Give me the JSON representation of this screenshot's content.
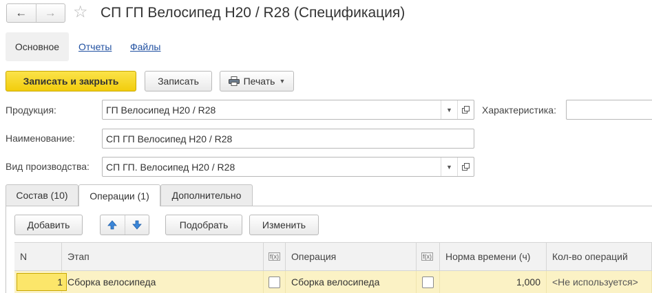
{
  "window": {
    "title": "СП ГП Велосипед H20 / R28 (Спецификация)",
    "nav_back_icon": "←",
    "nav_forward_icon": "→",
    "favorite_icon": "☆"
  },
  "sections": {
    "main": "Основное",
    "reports": "Отчеты",
    "files": "Файлы"
  },
  "commands": {
    "save_close": "Записать и закрыть",
    "save": "Записать",
    "print": "Печать"
  },
  "form": {
    "product_label": "Продукция:",
    "product_value": "ГП Велосипед H20 / R28",
    "characteristic_label": "Характеристика:",
    "characteristic_value": "",
    "name_label": "Наименование:",
    "name_value": "СП ГП Велосипед H20 / R28",
    "production_type_label": "Вид производства:",
    "production_type_value": "СП ГП. Велосипед H20 / R28"
  },
  "tabs": [
    {
      "label": "Состав (10)"
    },
    {
      "label": "Операции (1)",
      "active": true
    },
    {
      "label": "Дополнительно"
    }
  ],
  "table_toolbar": {
    "add": "Добавить",
    "select": "Подобрать",
    "change": "Изменить"
  },
  "table": {
    "columns": [
      "N",
      "Этап",
      "f(x)",
      "Операция",
      "f(x)",
      "Норма времени (ч)",
      "Кол-во операций"
    ],
    "rows": [
      {
        "n": "1",
        "stage": "Сборка велосипеда",
        "stage_formula": false,
        "operation": "Сборка велосипеда",
        "operation_formula": false,
        "time_norm": "1,000",
        "count": "<Не используется>"
      }
    ]
  },
  "colors": {
    "primary_button": "#f2cd0c",
    "selected_row": "#fbf2c5",
    "link": "#1f4fa0"
  }
}
